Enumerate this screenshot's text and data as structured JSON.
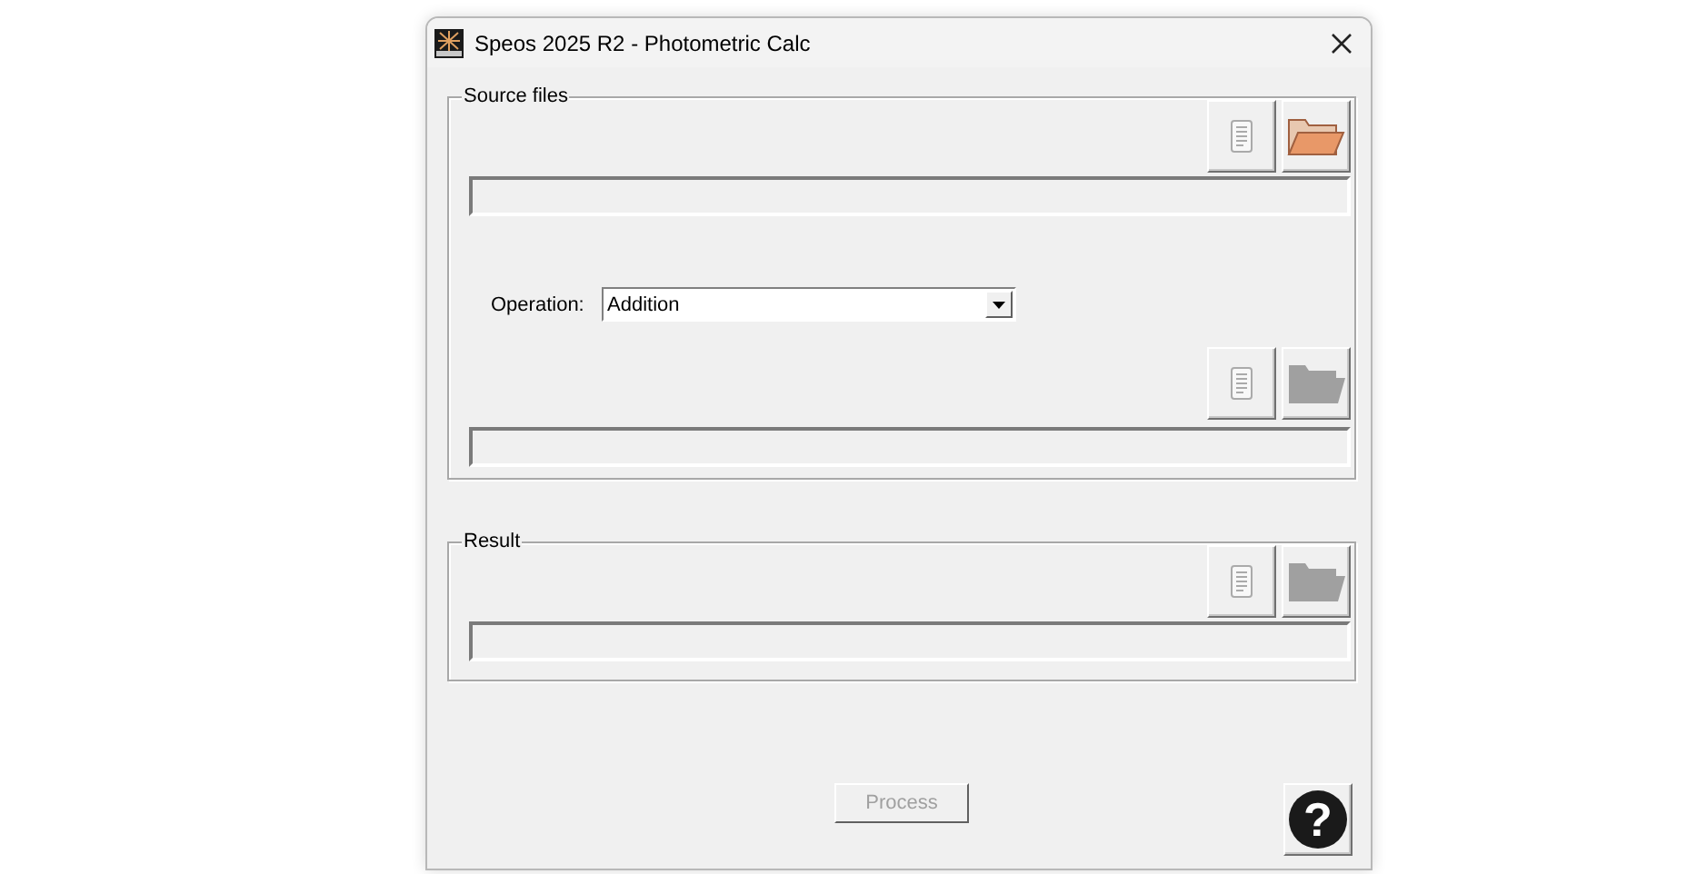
{
  "window": {
    "title": "Speos 2025 R2 - Photometric Calc"
  },
  "source_files": {
    "label": "Source files",
    "first_file": {
      "folder_enabled": true
    },
    "operation": {
      "label": "Operation:",
      "value": "Addition"
    },
    "second_file": {
      "folder_enabled": false
    }
  },
  "result": {
    "label": "Result",
    "file": {
      "folder_enabled": false
    }
  },
  "process_button": {
    "label": "Process",
    "disabled": true
  },
  "help_button": {
    "label": "?"
  }
}
